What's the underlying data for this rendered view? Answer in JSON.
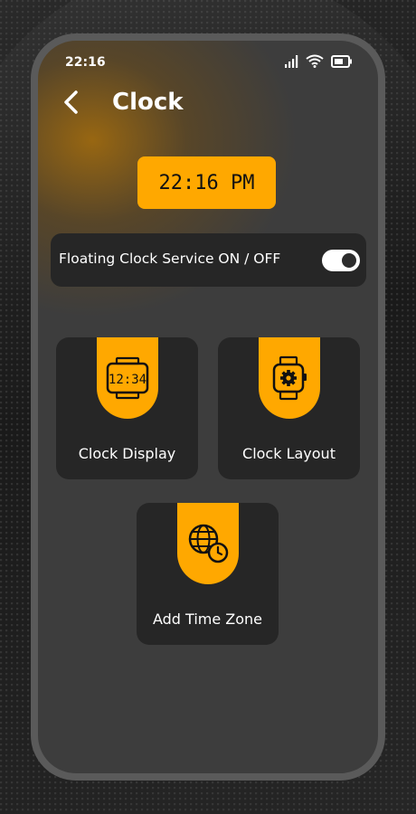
{
  "status_bar": {
    "time": "22:16",
    "icons": [
      "signal-icon",
      "wifi-icon",
      "battery-icon"
    ]
  },
  "header": {
    "back_icon": "back-arrow-icon",
    "title": "Clock"
  },
  "clock_display": {
    "time": "22:16 PM"
  },
  "floating_service": {
    "label": "Floating Clock Service ON / OFF",
    "enabled": true
  },
  "cards": [
    {
      "label": "Clock Display",
      "icon": "digital-clock-icon",
      "icon_text": "12:34"
    },
    {
      "label": "Clock Layout",
      "icon": "watch-settings-icon"
    },
    {
      "label": "Add Time Zone",
      "icon": "globe-clock-icon"
    }
  ],
  "colors": {
    "accent": "#ffa800",
    "card_bg": "#262626",
    "screen_bg": "#3d3d3d",
    "bezel": "#5a5a5a",
    "text": "#ffffff"
  }
}
